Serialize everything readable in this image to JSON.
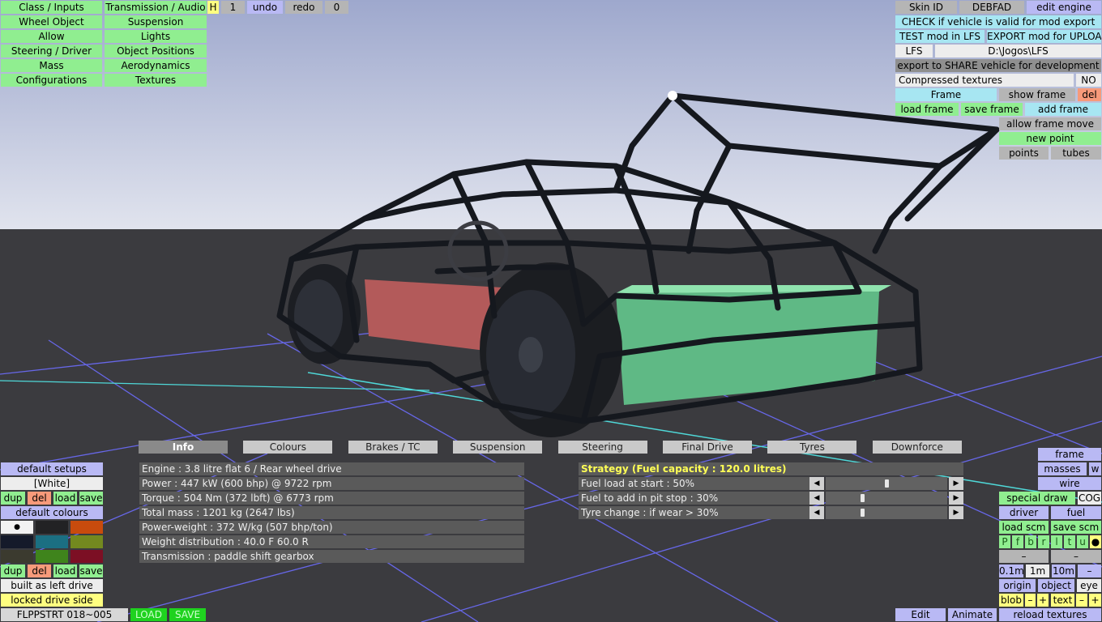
{
  "left_menu": [
    [
      "Class / Inputs",
      "Transmission / Audio"
    ],
    [
      "Wheel Object",
      "Suspension"
    ],
    [
      "Allow",
      "Lights"
    ],
    [
      "Steering / Driver",
      "Object Positions"
    ],
    [
      "Mass",
      "Aerodynamics"
    ],
    [
      "Configurations",
      "Textures"
    ]
  ],
  "top_tools": {
    "h": "H",
    "num": "1",
    "undo": "undo",
    "redo": "redo",
    "zero": "0"
  },
  "right_top": {
    "skin_id": "Skin ID",
    "debfad": "DEBFAD",
    "edit_engine": "edit engine",
    "check": "CHECK if vehicle is valid for mod export",
    "test": "TEST mod in LFS",
    "export_upload": "EXPORT mod for UPLOAD",
    "lfs": "LFS",
    "path": "D:\\Jogos\\LFS",
    "export_share": "export to SHARE vehicle for development",
    "compressed": "Compressed textures",
    "no": "NO",
    "frame": "Frame",
    "show_frame": "show frame",
    "del": "del",
    "load_frame": "load frame",
    "save_frame": "save frame",
    "add_frame": "add frame",
    "allow_move": "allow frame move",
    "new_point": "new point",
    "points": "points",
    "tubes": "tubes"
  },
  "tabs": [
    "Info",
    "Colours",
    "Brakes / TC",
    "Suspension",
    "Steering",
    "Final Drive",
    "Tyres",
    "Downforce"
  ],
  "active_tab": "Info",
  "info_lines": [
    "Engine : 3.8 litre flat 6 / Rear wheel drive",
    "Power : 447 kW (600 bhp) @ 9722 rpm",
    "Torque : 504 Nm (372 lbft) @ 6773 rpm",
    "Total mass : 1201 kg (2647 lbs)",
    "Power-weight : 372 W/kg (507 bhp/ton)",
    "Weight distribution : 40.0 F  60.0 R",
    "Transmission : paddle shift gearbox"
  ],
  "strategy": {
    "title": "Strategy (Fuel capacity : 120.0 litres)",
    "rows": [
      {
        "label": "Fuel load at start : 50%",
        "value": 0.5
      },
      {
        "label": "Fuel to add in pit stop : 30%",
        "value": 0.3
      },
      {
        "label": "Tyre change : if wear > 30%",
        "value": 0.3
      }
    ],
    "left_arrow": "◀",
    "right_arrow": "▶"
  },
  "left_bottom": {
    "default_setups": "default setups",
    "white": "[White]",
    "dup": "dup",
    "del": "del",
    "load": "load",
    "save": "save",
    "default_colours": "default colours",
    "swatch_dot": "●",
    "swatches": [
      "#f2f2f2",
      "#222224",
      "#c84b0d",
      "#151a2a",
      "#1b6f82",
      "#73891f",
      "#3b3a2f",
      "#3f841c",
      "#7c0f24"
    ],
    "built_left": "built as left drive",
    "locked_side": "locked drive side"
  },
  "status_bar": {
    "name": "FLPPSTRT 018~005",
    "load": "LOAD",
    "save": "SAVE"
  },
  "right_bottom": {
    "frame": "frame",
    "masses": "masses",
    "w": "w",
    "wire": "wire",
    "special_draw": "special draw",
    "cog": "COG",
    "driver": "driver",
    "fuel": "fuel",
    "load_scm": "load scm",
    "save_scm": "save scm",
    "letters": [
      "P",
      "f",
      "b",
      "r",
      "l",
      "t",
      "u",
      "●"
    ],
    "dash1": "–",
    "dash2": "–",
    "d01": "0.1m",
    "d1": "1m",
    "d10": "10m",
    "dminus": "–",
    "origin": "origin",
    "object": "object",
    "eye": "eye",
    "blob": "blob",
    "blob_minus": "–",
    "blob_plus": "+",
    "text": "text",
    "text_minus": "–",
    "text_plus": "+",
    "edit": "Edit",
    "animate": "Animate",
    "reload": "reload textures"
  },
  "colors": {
    "sky_top": "#aeb6d2",
    "sky_bottom": "#dfe2ec",
    "ground": "#3a3a3e",
    "grid": "#6e6ef0",
    "frame_tube": "#15181e",
    "fuel_box": "#b85a5a",
    "mass_box": "#5dbf83"
  }
}
